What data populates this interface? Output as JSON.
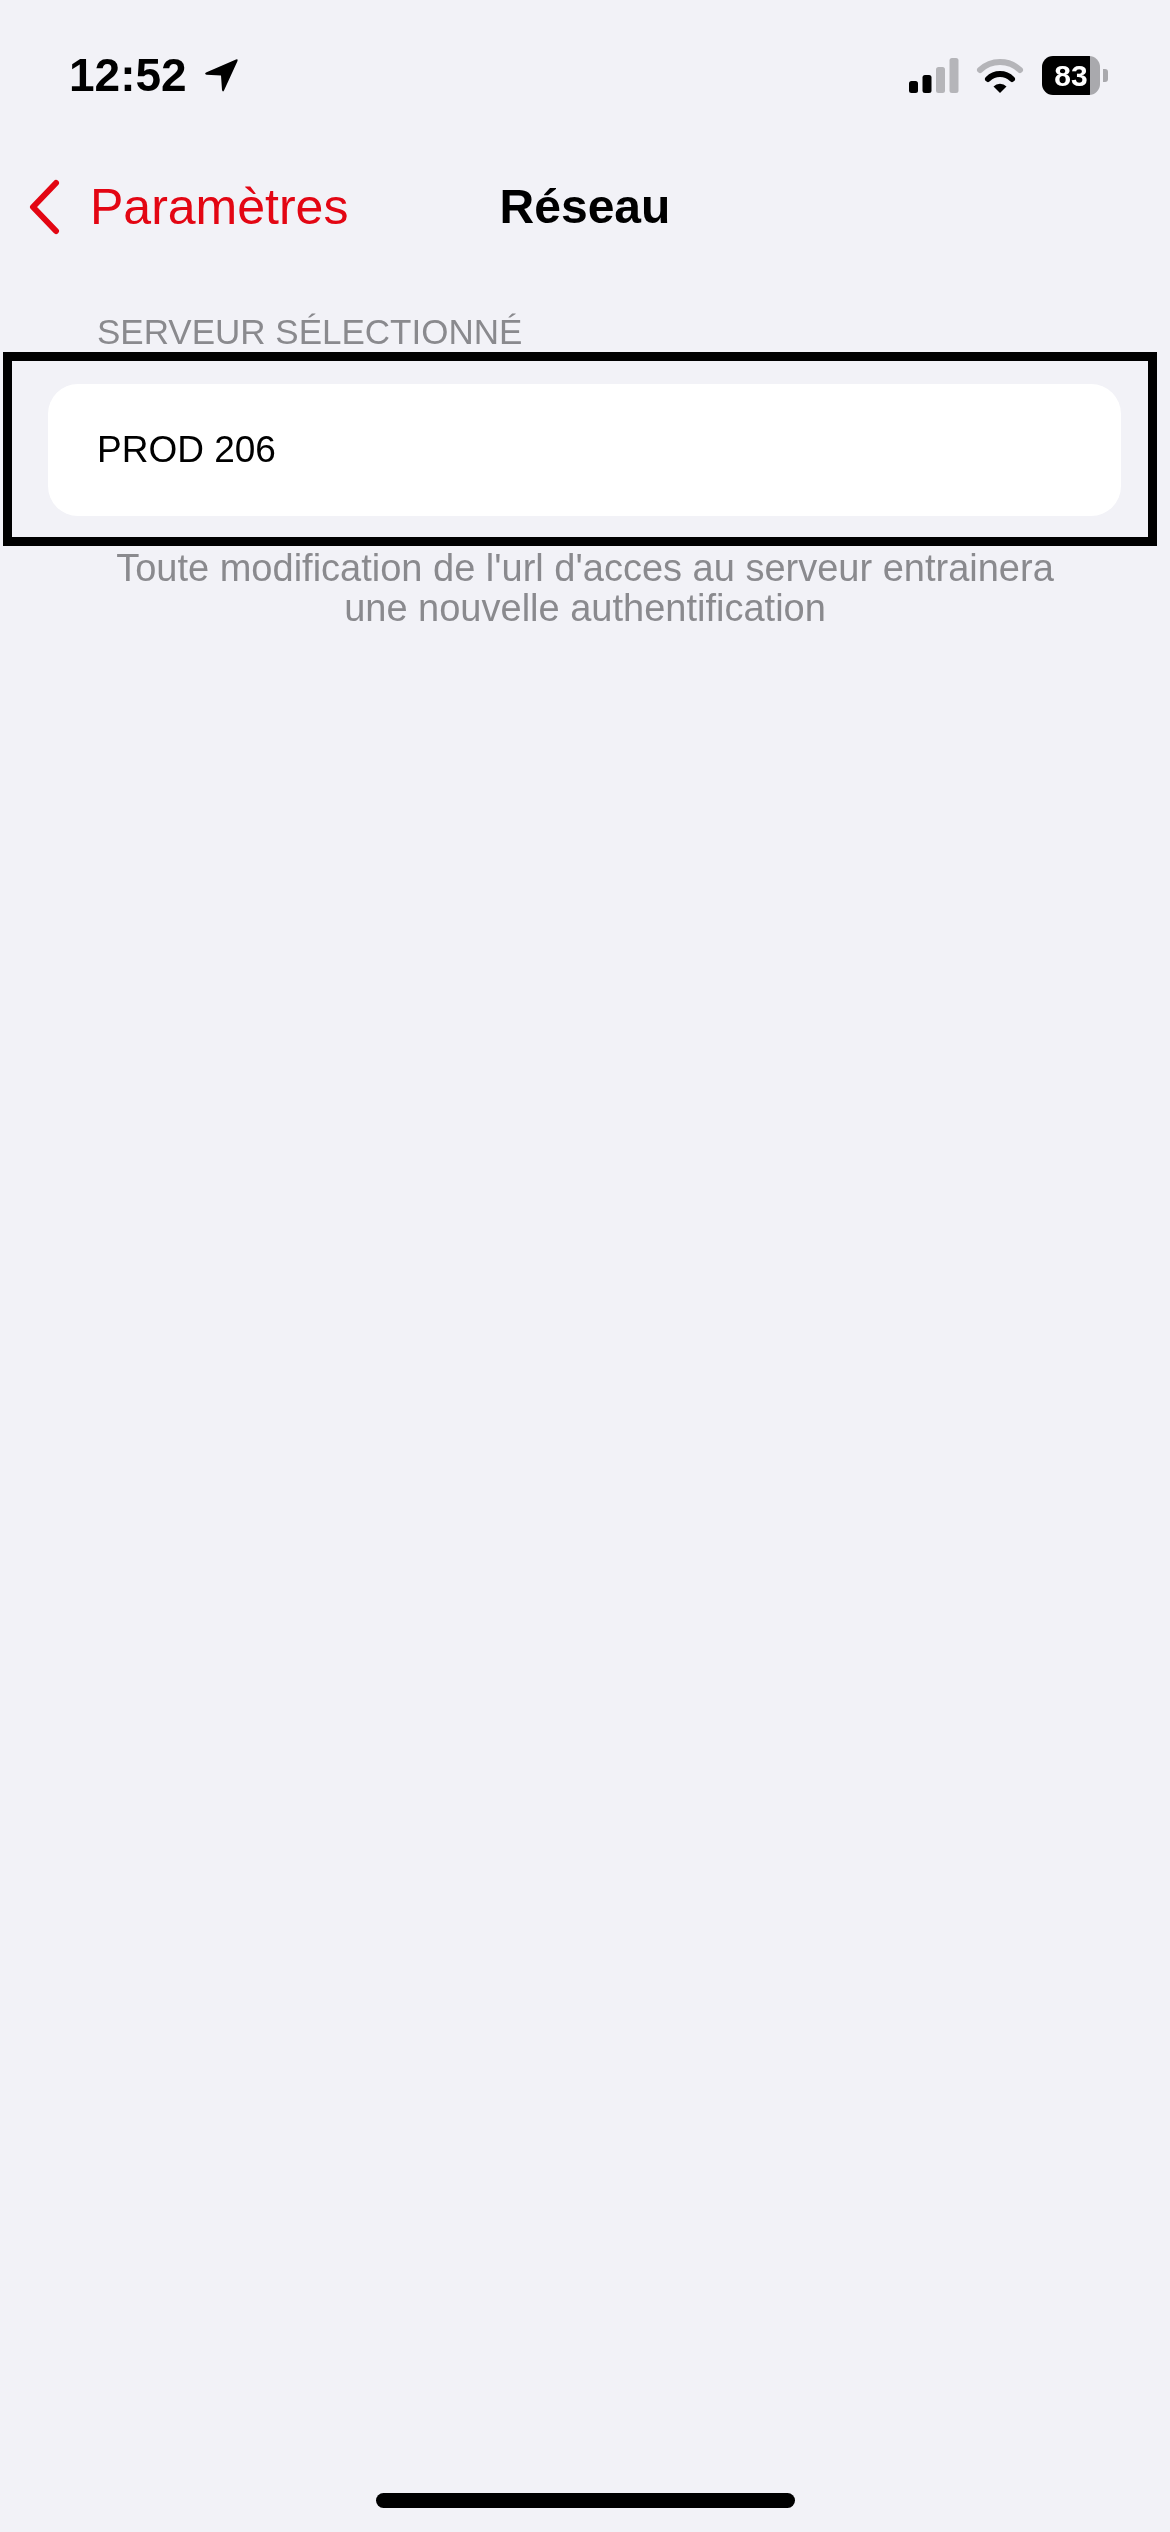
{
  "status_bar": {
    "time": "12:52",
    "battery": "83"
  },
  "nav": {
    "back": "Paramètres",
    "title": "Réseau"
  },
  "section": {
    "header": "SERVEUR SÉLECTIONNÉ",
    "highlighted": true,
    "value": "PROD 206",
    "footer": "Toute modification de l'url d'acces au serveur entrainera une nouvelle authentification"
  }
}
